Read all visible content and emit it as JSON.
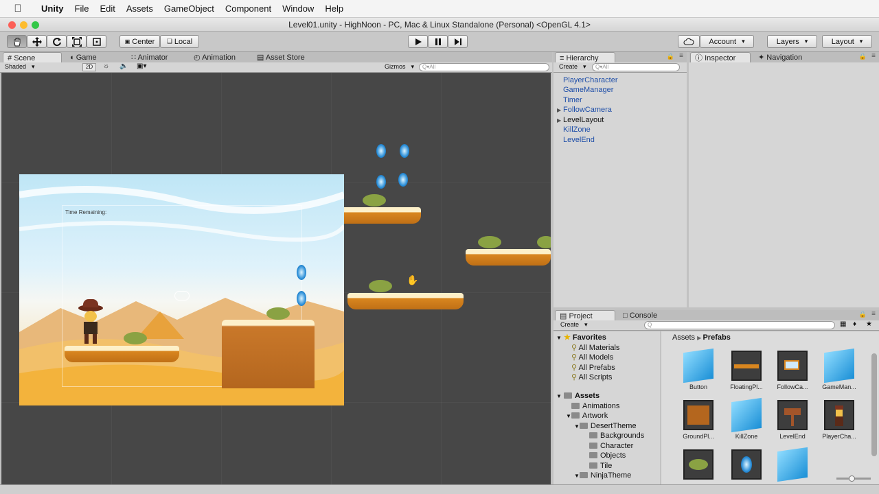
{
  "menubar": {
    "app": "Unity",
    "items": [
      "File",
      "Edit",
      "Assets",
      "GameObject",
      "Component",
      "Window",
      "Help"
    ]
  },
  "window": {
    "title": "Level01.unity - HighNoon - PC, Mac & Linux Standalone (Personal) <OpenGL 4.1>"
  },
  "toolbar": {
    "pivot_center": "Center",
    "pivot_local": "Local",
    "account": "Account",
    "layers": "Layers",
    "layout": "Layout"
  },
  "tabs": {
    "scene": "Scene",
    "game": "Game",
    "animator": "Animator",
    "animation": "Animation",
    "asset_store": "Asset Store",
    "hierarchy": "Hierarchy",
    "inspector": "Inspector",
    "navigation": "Navigation",
    "project": "Project",
    "console": "Console"
  },
  "scene_bar": {
    "shading": "Shaded",
    "mode_2d": "2D",
    "gizmos": "Gizmos",
    "search": "Q▾All"
  },
  "game_ui": {
    "time_label": "Time Remaining:"
  },
  "hierarchy": {
    "create": "Create",
    "search": "Q▾All",
    "items": [
      {
        "label": "PlayerCharacter",
        "expandable": false,
        "prefab": true
      },
      {
        "label": "GameManager",
        "expandable": false,
        "prefab": true
      },
      {
        "label": "Timer",
        "expandable": false,
        "prefab": true
      },
      {
        "label": "FollowCamera",
        "expandable": true,
        "prefab": true
      },
      {
        "label": "LevelLayout",
        "expandable": true,
        "prefab": false
      },
      {
        "label": "KillZone",
        "expandable": false,
        "prefab": true
      },
      {
        "label": "LevelEnd",
        "expandable": false,
        "prefab": true
      }
    ]
  },
  "project": {
    "create": "Create",
    "breadcrumb_root": "Assets",
    "breadcrumb_current": "Prefabs",
    "favorites_label": "Favorites",
    "favorites": [
      "All Materials",
      "All Models",
      "All Prefabs",
      "All Scripts"
    ],
    "assets_label": "Assets",
    "tree": [
      "Animations",
      "Artwork",
      "DesertTheme",
      "Backgrounds",
      "Character",
      "Objects",
      "Tile",
      "NinjaTheme"
    ],
    "assets": [
      "Button",
      "FloatingPl...",
      "FollowCa...",
      "GameMan...",
      "GroundPl...",
      "KillZone",
      "LevelEnd",
      "PlayerCha..."
    ]
  }
}
